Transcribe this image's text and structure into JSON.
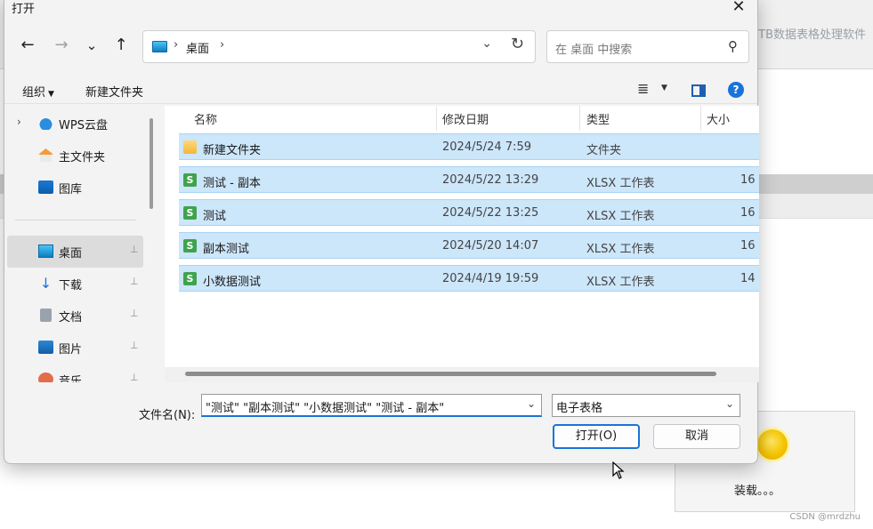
{
  "background": {
    "app_title": "TB数据表格处理软件",
    "loading_text": "装载。。。",
    "watermark": "CSDN @mrdzhu"
  },
  "dialog": {
    "title": "打开",
    "close_label": "✕",
    "nav": {
      "back_icon": "←",
      "forward_icon": "→",
      "recent_icon": "⌄",
      "up_icon": "↑"
    },
    "address": {
      "location": "桌面",
      "separator": "›"
    },
    "search": {
      "placeholder": "在 桌面 中搜索"
    },
    "toolbar": {
      "organize_label": "组织",
      "new_folder_label": "新建文件夹",
      "view_icon": "≣",
      "help_label": "?"
    },
    "sidebar": {
      "items": [
        {
          "label": "WPS云盘",
          "icon": "cloud-icon"
        },
        {
          "label": "主文件夹",
          "icon": "home-icon"
        },
        {
          "label": "图库",
          "icon": "gallery-icon"
        },
        {
          "label": "桌面",
          "icon": "desktop-icon",
          "pinned": true,
          "selected": true
        },
        {
          "label": "下载",
          "icon": "download-icon",
          "pinned": true
        },
        {
          "label": "文档",
          "icon": "document-icon",
          "pinned": true
        },
        {
          "label": "图片",
          "icon": "pictures-icon",
          "pinned": true
        },
        {
          "label": "音乐",
          "icon": "music-icon",
          "pinned": true
        }
      ]
    },
    "columns": {
      "name": "名称",
      "modified": "修改日期",
      "type": "类型",
      "size": "大小"
    },
    "files": [
      {
        "name": "新建文件夹",
        "modified": "2024/5/24 7:59",
        "type": "文件夹",
        "size": ""
      },
      {
        "name": "测试 - 副本",
        "modified": "2024/5/22 13:29",
        "type": "XLSX 工作表",
        "size": "16"
      },
      {
        "name": "测试",
        "modified": "2024/5/22 13:25",
        "type": "XLSX 工作表",
        "size": "16"
      },
      {
        "name": "副本测试",
        "modified": "2024/5/20 14:07",
        "type": "XLSX 工作表",
        "size": "16"
      },
      {
        "name": "小数据测试",
        "modified": "2024/4/19 19:59",
        "type": "XLSX 工作表",
        "size": "14"
      }
    ],
    "filename": {
      "label": "文件名(N):",
      "value": "\"测试\" \"副本测试\" \"小数据测试\" \"测试 - 副本\""
    },
    "filetype": {
      "value": "电子表格"
    },
    "open_label": "打开(O)",
    "cancel_label": "取消"
  }
}
